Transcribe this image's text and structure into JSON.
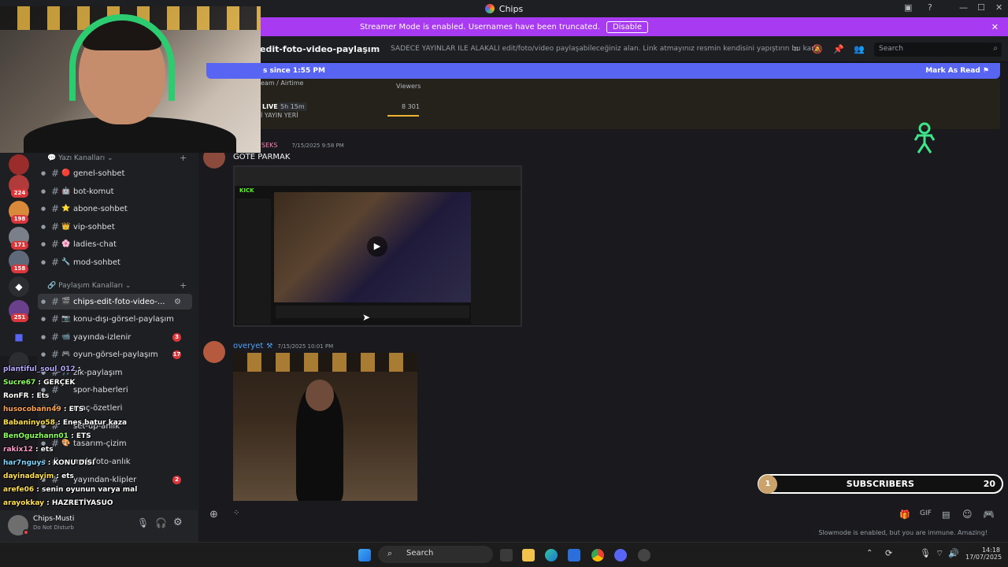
{
  "window": {
    "title": "Chips"
  },
  "banner": {
    "text": "Streamer Mode is enabled. Usernames have been truncated.",
    "disable_label": "Disable"
  },
  "header": {
    "channel_name": "edit-foto-video-paylaşım",
    "topic": "SADECE YAYINLAR İLE ALAKALI edit/foto/video paylaşabileceğiniz alan. Link atmayınız resmin kendisini yapıştırın bu kanala lütfen...",
    "search_placeholder": "Search"
  },
  "new_messages_bar": {
    "text": "s since 1:55 PM",
    "mark_read_label": "Mark As Read"
  },
  "embed": {
    "col_stream": "eam / Airtime",
    "col_viewers": "Viewers",
    "live_label": "LIVE",
    "duration": "5h 15m",
    "viewer_count": "8 301",
    "sub_text": "İ YAYIN YERİ"
  },
  "messages": [
    {
      "author": "SEKS",
      "timestamp": "7/15/2025 9:58 PM",
      "text": "GOTE PARMAK"
    },
    {
      "author": "overyet",
      "timestamp": "7/15/2025 10:01 PM",
      "text": ""
    }
  ],
  "sidebar": {
    "categories": [
      "Yazı Kanalları",
      "Paylaşım Kanalları"
    ],
    "channels": [
      {
        "name": "genel-sohbet",
        "emoji": "🔴",
        "badge": ""
      },
      {
        "name": "bot-komut",
        "emoji": "🤖",
        "badge": ""
      },
      {
        "name": "abone-sohbet",
        "emoji": "⭐",
        "badge": ""
      },
      {
        "name": "vip-sohbet",
        "emoji": "👑",
        "badge": ""
      },
      {
        "name": "ladies-chat",
        "emoji": "🌸",
        "badge": ""
      },
      {
        "name": "mod-sohbet",
        "emoji": "🔧",
        "badge": ""
      },
      {
        "name": "chips-edit-foto-video-...",
        "emoji": "🎬",
        "badge": ""
      },
      {
        "name": "konu-dışı-görsel-paylaşım",
        "emoji": "📷",
        "badge": ""
      },
      {
        "name": "yayında-izlenir",
        "emoji": "📹",
        "badge": "3"
      },
      {
        "name": "oyun-görsel-paylaşım",
        "emoji": "🎮",
        "badge": "17"
      },
      {
        "name": "zik-paylaşım",
        "emoji": "🎵",
        "badge": ""
      },
      {
        "name": "spor-haberleri",
        "emoji": "",
        "badge": ""
      },
      {
        "name": "maç-özetleri",
        "emoji": "",
        "badge": ""
      },
      {
        "name": "set-up-anlık",
        "emoji": "",
        "badge": ""
      },
      {
        "name": "tasarım-çizim",
        "emoji": "🎨",
        "badge": ""
      },
      {
        "name": "mek-foto-anlık",
        "emoji": "",
        "badge": ""
      },
      {
        "name": "yayından-klipler",
        "emoji": "",
        "badge": "2"
      }
    ]
  },
  "servers": {
    "badges": [
      "224",
      "198",
      "171",
      "158",
      "251"
    ]
  },
  "chat_overlay": [
    {
      "user": "plantiful_soul_012",
      "msg": "",
      "color": "#b9a8ff"
    },
    {
      "user": "Sucre67",
      "msg": "GERÇEK",
      "color": "#8bff5c"
    },
    {
      "user": "RonFR",
      "msg": "Ets",
      "color": "#ffffff"
    },
    {
      "user": "husocobann49",
      "msg": "ETS",
      "color": "#ffa24c"
    },
    {
      "user": "Babaninyo58",
      "msg": "Enes batur kaza",
      "color": "#ffe04c"
    },
    {
      "user": "BenOguzhann01",
      "msg": "ETS",
      "color": "#8bff5c"
    },
    {
      "user": "rakix12",
      "msg": "ets",
      "color": "#ff9acb"
    },
    {
      "user": "har7nguys",
      "msg": "KONU DISI",
      "color": "#7ad7ff"
    },
    {
      "user": "dayinadayim",
      "msg": "ets",
      "color": "#ffe04c"
    },
    {
      "user": "arefe06",
      "msg": "senin oyunun varya mal",
      "color": "#ffe04c"
    },
    {
      "user": "arayokkay",
      "msg": "HAZRETİYASUO",
      "color": "#ffe04c"
    }
  ],
  "user_panel": {
    "name": "Chips-Musti",
    "status": "Do Not Disturb"
  },
  "overlay": {
    "subscribers_label": "SUBSCRIBERS",
    "subscribers_count": "20",
    "goal_step": "1"
  },
  "composer": {
    "slowmode_text": "Slowmode is enabled, but you are immune. Amazing!"
  },
  "taskbar": {
    "search_label": "Search",
    "time": "14:18",
    "date": "17/07/2025"
  }
}
